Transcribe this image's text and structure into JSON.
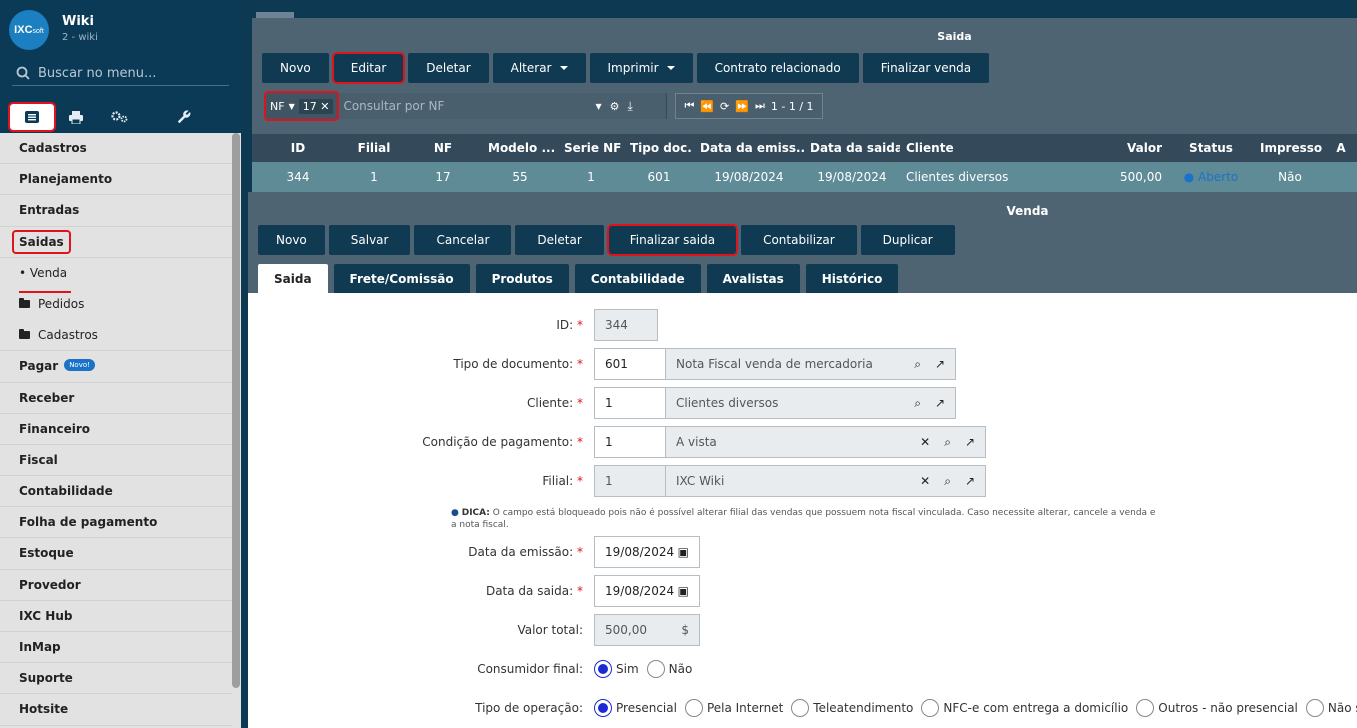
{
  "app": {
    "logo_text": "IXC",
    "logo_sub": "soft",
    "title": "Wiki",
    "subtitle": "2 - wiki"
  },
  "sidebar": {
    "search_placeholder": "Buscar no menu...",
    "items": [
      {
        "label": "Cadastros"
      },
      {
        "label": "Planejamento"
      },
      {
        "label": "Entradas"
      },
      {
        "label": "Saidas"
      },
      {
        "label": "Venda"
      },
      {
        "label": "Pedidos"
      },
      {
        "label": "Cadastros"
      },
      {
        "label": "Pagar",
        "badge": "Novo!"
      },
      {
        "label": "Receber"
      },
      {
        "label": "Financeiro"
      },
      {
        "label": "Fiscal"
      },
      {
        "label": "Contabilidade"
      },
      {
        "label": "Folha de pagamento"
      },
      {
        "label": "Estoque"
      },
      {
        "label": "Provedor"
      },
      {
        "label": "IXC Hub"
      },
      {
        "label": "InMap"
      },
      {
        "label": "Suporte"
      },
      {
        "label": "Hotsite"
      }
    ]
  },
  "saida_window": {
    "title": "Saida",
    "toolbar": {
      "novo": "Novo",
      "editar": "Editar",
      "deletar": "Deletar",
      "alterar": "Alterar",
      "imprimir": "Imprimir",
      "contrato": "Contrato relacionado",
      "finalizar": "Finalizar venda"
    },
    "search": {
      "field": "NF",
      "chip": "17",
      "placeholder": "Consultar por NF",
      "pager": "1 - 1 / 1"
    },
    "grid": {
      "columns": [
        "ID",
        "Filial",
        "NF",
        "Modelo ...",
        "Serie NF",
        "Tipo doc.",
        "Data da emiss...",
        "Data da saida",
        "Cliente",
        "Valor",
        "Status",
        "Impresso",
        "A"
      ],
      "row": [
        "344",
        "1",
        "17",
        "55",
        "1",
        "601",
        "19/08/2024",
        "19/08/2024",
        "Clientes diversos",
        "500,00",
        "Aberto",
        "Não",
        ""
      ]
    }
  },
  "venda_window": {
    "title": "Venda",
    "toolbar": {
      "novo": "Novo",
      "salvar": "Salvar",
      "cancelar": "Cancelar",
      "deletar": "Deletar",
      "finalizar": "Finalizar saida",
      "contabilizar": "Contabilizar",
      "duplicar": "Duplicar"
    },
    "tabs": [
      "Saida",
      "Frete/Comissão",
      "Produtos",
      "Contabilidade",
      "Avalistas",
      "Histórico"
    ],
    "form": {
      "id_label": "ID:",
      "id_value": "344",
      "tipo_label": "Tipo de documento:",
      "tipo_value": "601",
      "tipo_desc": "Nota Fiscal venda de mercadoria",
      "cliente_label": "Cliente:",
      "cliente_value": "1",
      "cliente_desc": "Clientes diversos",
      "cond_label": "Condição de pagamento:",
      "cond_value": "1",
      "cond_desc": "A vista",
      "filial_label": "Filial:",
      "filial_value": "1",
      "filial_desc": "IXC Wiki",
      "dica_title": "DICA:",
      "dica_text": " O campo está bloqueado pois não é possível alterar filial das vendas que possuem nota fiscal vinculada. Caso necessite alterar, cancele a venda e a nota fiscal.",
      "emissao_label": "Data da emissão:",
      "emissao_value": "19/08/2024",
      "saida_label": "Data da saida:",
      "saida_value": "19/08/2024",
      "valor_label": "Valor total:",
      "valor_value": "500,00",
      "consumidor_label": "Consumidor final:",
      "consumidor_options": [
        "Sim",
        "Não"
      ],
      "operacao_label": "Tipo de operação:",
      "operacao_options": [
        "Presencial",
        "Pela Internet",
        "Teleatendimento",
        "NFC-e com entrega a domicílio",
        "Outros - não presencial",
        "Não se aplica"
      ]
    }
  },
  "colors": {
    "highlight": "#e0131b",
    "nav_dark": "#0f3a52",
    "status_blue": "#1a73c9"
  }
}
